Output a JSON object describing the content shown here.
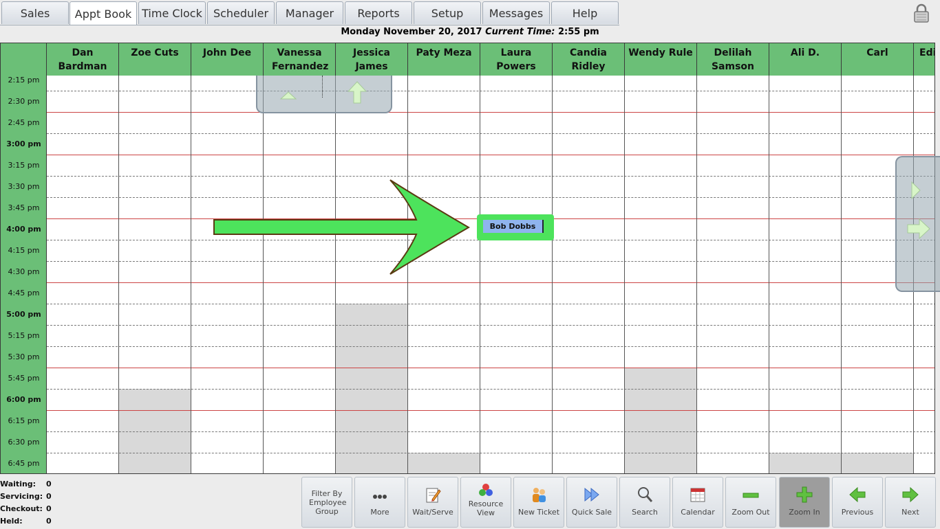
{
  "tabs": [
    {
      "label": "Sales",
      "active": false
    },
    {
      "label": "Appt Book",
      "active": true
    },
    {
      "label": "Time Clock",
      "active": false
    },
    {
      "label": "Scheduler",
      "active": false
    },
    {
      "label": "Manager",
      "active": false
    },
    {
      "label": "Reports",
      "active": false
    },
    {
      "label": "Setup",
      "active": false
    },
    {
      "label": "Messages",
      "active": false
    },
    {
      "label": "Help",
      "active": false
    }
  ],
  "header": {
    "date": "Monday November 20, 2017",
    "current_time_label": "Current Time:",
    "current_time": "2:55 pm"
  },
  "employees": [
    "Dan Bardman",
    "Zoe Cuts",
    "John Dee",
    "Vanessa Fernandez",
    "Jessica James",
    "Paty Meza",
    "Laura Powers",
    "Candia Ridley",
    "Wendy Rule",
    "Delilah Samson",
    "Ali D.",
    "Carl",
    "Edi"
  ],
  "times": [
    "2:15 pm",
    "2:30 pm",
    "2:45 pm",
    "3:00 pm",
    "3:15 pm",
    "3:30 pm",
    "3:45 pm",
    "4:00 pm",
    "4:15 pm",
    "4:30 pm",
    "4:45 pm",
    "5:00 pm",
    "5:15 pm",
    "5:30 pm",
    "5:45 pm",
    "6:00 pm",
    "6:15 pm",
    "6:30 pm",
    "6:45 pm"
  ],
  "appointment": {
    "client": "Bob Dobbs",
    "employee": "Laura Powers",
    "time": "4:00 pm"
  },
  "colors": {
    "header_green": "#6bbf77",
    "appt_highlight": "#4de35c",
    "appt_fill": "#8fb4ee",
    "unavailable": "#d9d9d9"
  },
  "stats": [
    {
      "label": "Waiting:",
      "value": "0"
    },
    {
      "label": "Servicing:",
      "value": "0"
    },
    {
      "label": "Checkout:",
      "value": "0"
    },
    {
      "label": "Held:",
      "value": "0"
    }
  ],
  "toolbar": [
    {
      "label": "Filter By Employee Group",
      "icon": "filter-icon",
      "active": false
    },
    {
      "label": "More",
      "icon": "more-dots-icon",
      "active": false
    },
    {
      "label": "Wait/Serve",
      "icon": "wait-serve-icon",
      "active": false
    },
    {
      "label": "Resource View",
      "icon": "resource-icon",
      "active": false
    },
    {
      "label": "New Ticket",
      "icon": "new-ticket-icon",
      "active": false
    },
    {
      "label": "Quick Sale",
      "icon": "quick-sale-icon",
      "active": false
    },
    {
      "label": "Search",
      "icon": "search-icon",
      "active": false
    },
    {
      "label": "Calendar",
      "icon": "calendar-icon",
      "active": false
    },
    {
      "label": "Zoom Out",
      "icon": "zoom-out-icon",
      "active": false
    },
    {
      "label": "Zoom In",
      "icon": "zoom-in-icon",
      "active": true
    },
    {
      "label": "Previous",
      "icon": "previous-arrow-icon",
      "active": false
    },
    {
      "label": "Next",
      "icon": "next-arrow-icon",
      "active": false
    }
  ]
}
